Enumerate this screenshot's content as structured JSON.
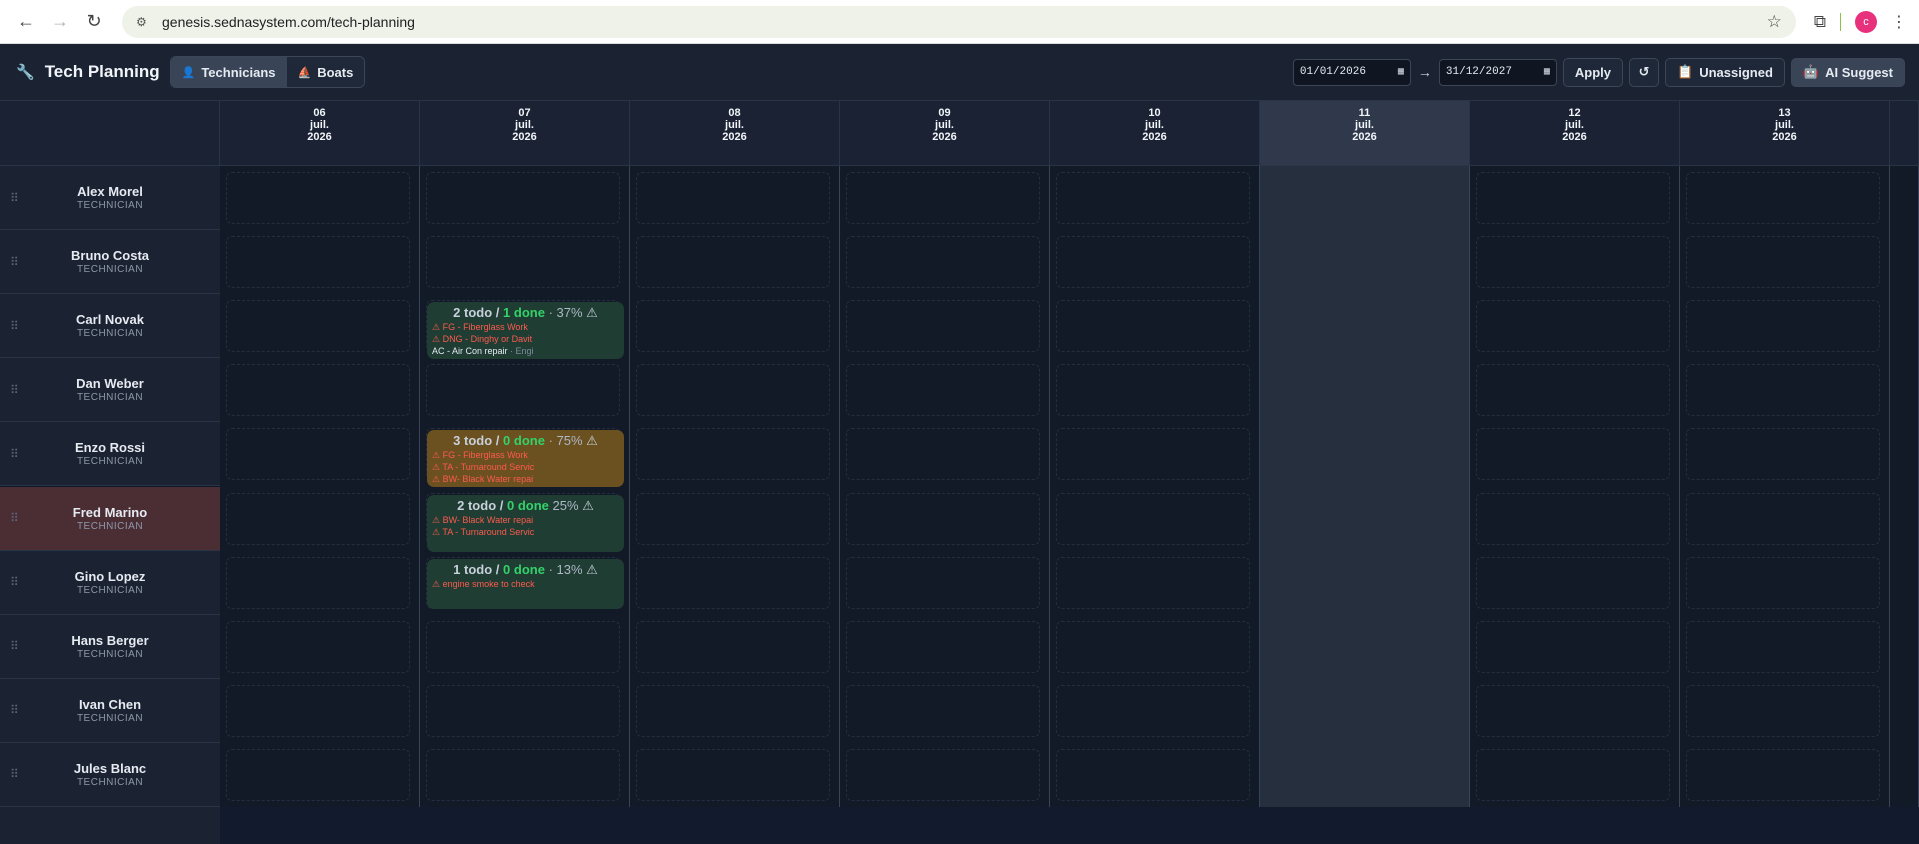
{
  "browser": {
    "url": "genesis.sednasystem.com/tech-planning",
    "profile_initial": "c"
  },
  "header": {
    "title": "Tech Planning",
    "toggle": [
      {
        "label": "Technicians",
        "active": true,
        "icon": "person-icon"
      },
      {
        "label": "Boats",
        "active": false,
        "icon": "sailboat-icon"
      }
    ],
    "date_from": "01/01/2026",
    "date_to": "31/12/2027",
    "arrow": "→",
    "apply_label": "Apply",
    "refresh_icon": "↺",
    "unassigned_label": "Unassigned",
    "ai_label": "AI Suggest"
  },
  "days": [
    {
      "day": "06",
      "month": "juil.",
      "year": "2026",
      "today": false
    },
    {
      "day": "07",
      "month": "juil.",
      "year": "2026",
      "today": false
    },
    {
      "day": "08",
      "month": "juil.",
      "year": "2026",
      "today": false
    },
    {
      "day": "09",
      "month": "juil.",
      "year": "2026",
      "today": false
    },
    {
      "day": "10",
      "month": "juil.",
      "year": "2026",
      "today": false
    },
    {
      "day": "11",
      "month": "juil.",
      "year": "2026",
      "today": true
    },
    {
      "day": "12",
      "month": "juil.",
      "year": "2026",
      "today": false
    },
    {
      "day": "13",
      "month": "juil.",
      "year": "2026",
      "today": false
    }
  ],
  "technicians": [
    {
      "name": "Alex Morel",
      "role": "TECHNICIAN"
    },
    {
      "name": "Bruno Costa",
      "role": "TECHNICIAN"
    },
    {
      "name": "Carl Novak",
      "role": "TECHNICIAN"
    },
    {
      "name": "Dan Weber",
      "role": "TECHNICIAN"
    },
    {
      "name": "Enzo Rossi",
      "role": "TECHNICIAN"
    },
    {
      "name": "Fred Marino",
      "role": "TECHNICIAN"
    },
    {
      "name": "Gino Lopez",
      "role": "TECHNICIAN"
    },
    {
      "name": "Hans Berger",
      "role": "TECHNICIAN"
    },
    {
      "name": "Ivan Chen",
      "role": "TECHNICIAN"
    },
    {
      "name": "Jules Blanc",
      "role": "TECHNICIAN"
    }
  ],
  "cards": [
    {
      "tech": 2,
      "day": 1,
      "color": "green",
      "todo": "2 todo",
      "sep": "/",
      "done": "1 done",
      "pct": "· 37%",
      "warn": "⚠",
      "lines": [
        {
          "text": "⚠ FG - Fiberglass Work",
          "status": "warn"
        },
        {
          "text": "⚠ DNG - Dinghy or Davit",
          "status": "warn"
        },
        {
          "text": "AC - Air Con repair",
          "sub": "· Engi",
          "status": "ok"
        }
      ]
    },
    {
      "tech": 4,
      "day": 1,
      "color": "amber",
      "todo": "3 todo",
      "sep": "/",
      "done": "0 done",
      "pct": "· 75%",
      "warn": "⚠",
      "lines": [
        {
          "text": "⚠ FG - Fiberglass Work",
          "status": "warn"
        },
        {
          "text": "⚠ TA - Turnaround Servic",
          "status": "warn"
        },
        {
          "text": "⚠ BW- Black Water repai",
          "status": "warn"
        }
      ]
    },
    {
      "tech": 5,
      "day": 1,
      "color": "green",
      "todo": "2 todo",
      "sep": "/",
      "done": "0 done",
      "pct": "25%",
      "warn": "⚠",
      "lines": [
        {
          "text": "⚠ BW- Black Water repai",
          "status": "warn"
        },
        {
          "text": "⚠ TA - Turnaround Servic",
          "status": "warn"
        }
      ]
    },
    {
      "tech": 6,
      "day": 1,
      "color": "green",
      "todo": "1 todo",
      "sep": "/",
      "done": "0 done",
      "pct": "· 13%",
      "warn": "⚠",
      "lines": [
        {
          "text": "⚠ engine smoke to check",
          "status": "warn"
        }
      ]
    }
  ]
}
